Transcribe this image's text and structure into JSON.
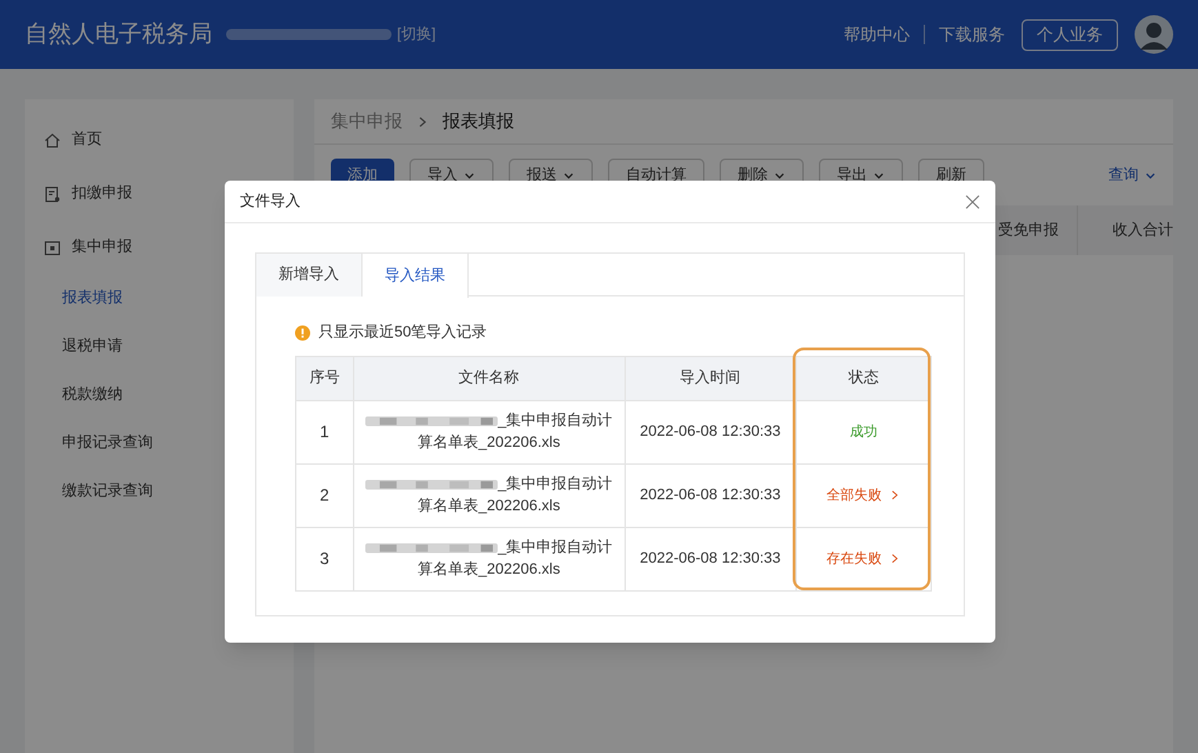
{
  "header": {
    "title": "自然人电子税务局",
    "switch_link": "[切换]",
    "links": [
      "帮助中心",
      "下载服务"
    ],
    "personal_button": "个人业务"
  },
  "sidebar": {
    "items": [
      {
        "label": "首页",
        "kind": "home",
        "selected": false
      },
      {
        "label": "扣缴申报",
        "kind": "doc",
        "selected": false
      },
      {
        "label": "集中申报",
        "kind": "box",
        "selected": false,
        "children": [
          {
            "label": "报表填报",
            "selected": true
          },
          {
            "label": "退税申请",
            "selected": false
          },
          {
            "label": "税款缴纳",
            "selected": false
          },
          {
            "label": "申报记录查询",
            "selected": false
          },
          {
            "label": "缴款记录查询",
            "selected": false
          }
        ]
      }
    ]
  },
  "breadcrumb": [
    "集中申报",
    "报表填报"
  ],
  "toolbar": {
    "buttons": [
      {
        "label": "添加",
        "primary": true,
        "dropdown": false
      },
      {
        "label": "导入",
        "primary": false,
        "dropdown": true
      },
      {
        "label": "报送",
        "primary": false,
        "dropdown": true
      },
      {
        "label": "自动计算",
        "primary": false,
        "dropdown": false
      },
      {
        "label": "删除",
        "primary": false,
        "dropdown": true
      },
      {
        "label": "导出",
        "primary": false,
        "dropdown": true
      },
      {
        "label": "刷新",
        "primary": false,
        "dropdown": false
      }
    ],
    "query": "查询"
  },
  "background_table": {
    "columns": [
      "受免申报",
      "收入合计"
    ]
  },
  "dialog": {
    "title": "文件导入",
    "tabs": [
      {
        "label": "新增导入",
        "selected": false
      },
      {
        "label": "导入结果",
        "selected": true
      }
    ],
    "notice": "只显示最近50笔导入记录",
    "table": {
      "columns": [
        "序号",
        "文件名称",
        "导入时间",
        "状态"
      ],
      "rows": [
        {
          "index": "1",
          "file_name": "_集中申报自动计算名单表_202206.xls",
          "time": "2022-06-08 12:30:33",
          "status": "成功",
          "kind": "success"
        },
        {
          "index": "2",
          "file_name": "_集中申报自动计算名单表_202206.xls",
          "time": "2022-06-08 12:30:33",
          "status": "全部失败",
          "kind": "fail"
        },
        {
          "index": "3",
          "file_name": "_集中申报自动计算名单表_202206.xls",
          "time": "2022-06-08 12:30:33",
          "status": "存在失败",
          "kind": "fail"
        }
      ]
    }
  }
}
